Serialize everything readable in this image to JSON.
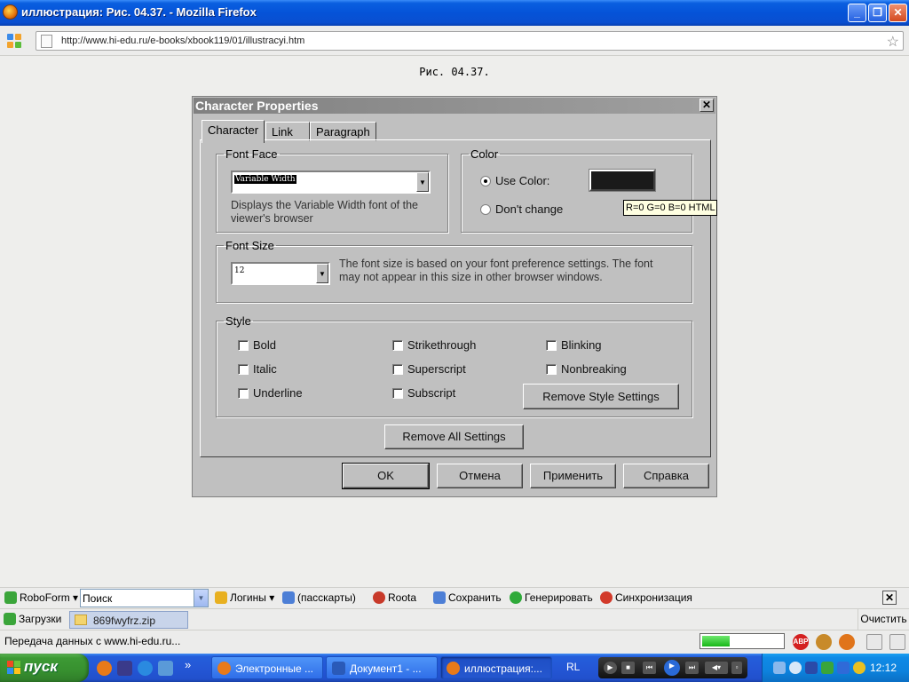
{
  "window": {
    "title": "иллюстрация: Рис. 04.37. - Mozilla Firefox",
    "minimize": "_",
    "restore": "❐",
    "close": "✕"
  },
  "browser": {
    "url": "http://www.hi-edu.ru/e-books/xbook119/01/illustracyi.htm",
    "bookmark_icon": "star-icon"
  },
  "page": {
    "caption": "Рис. 04.37."
  },
  "dialog": {
    "title": "Character Properties",
    "close": "✕",
    "tabs": [
      {
        "label": "Character",
        "active": true
      },
      {
        "label": "Link",
        "active": false
      },
      {
        "label": "Paragraph",
        "active": false
      }
    ],
    "font_face": {
      "legend": "Font Face",
      "value": "Variable Width",
      "help": "Displays the Variable Width font of the viewer's browser"
    },
    "color": {
      "legend": "Color",
      "use_color": "Use Color:",
      "dont_change": "Don't change",
      "selected": "use_color",
      "swatch": "#1a1a1a"
    },
    "tooltip": "R=0 G=0 B=0  HTML",
    "font_size": {
      "legend": "Font Size",
      "value": "12",
      "help": "The font size is based on your font preference settings. The font may not appear in this size in other browser windows."
    },
    "style": {
      "legend": "Style",
      "options": [
        {
          "label": "Bold",
          "checked": false
        },
        {
          "label": "Italic",
          "checked": false
        },
        {
          "label": "Underline",
          "checked": false
        },
        {
          "label": "Strikethrough",
          "checked": false
        },
        {
          "label": "Superscript",
          "checked": false
        },
        {
          "label": "Subscript",
          "checked": false
        },
        {
          "label": "Blinking",
          "checked": false
        },
        {
          "label": "Nonbreaking",
          "checked": false
        }
      ],
      "remove_style": "Remove Style Settings"
    },
    "remove_all": "Remove All Settings",
    "buttons": {
      "ok": "OK",
      "cancel": "Отмена",
      "apply": "Применить",
      "help": "Справка"
    }
  },
  "roboform": {
    "brand": "RoboForm",
    "search_value": "Поиск",
    "logins": "Логины",
    "passcards": "(пасскарты)",
    "roota": "Roota",
    "save": "Сохранить",
    "generate": "Генерировать",
    "sync": "Синхронизация",
    "close": "✕"
  },
  "downloads": {
    "label": "Загрузки",
    "file": "869fwyfrz.zip",
    "clear": "Очистить"
  },
  "status": {
    "message": "Передача данных с www.hi-edu.ru...",
    "progress": 0.35
  },
  "taskbar": {
    "start": "пуск",
    "more": "»",
    "tasks": [
      {
        "label": "Электронные ...",
        "active": false
      },
      {
        "label": "Документ1 - ...",
        "active": false
      },
      {
        "label": "иллюстрация:...",
        "active": true
      }
    ],
    "lang": "RL",
    "clock": "12:12"
  }
}
